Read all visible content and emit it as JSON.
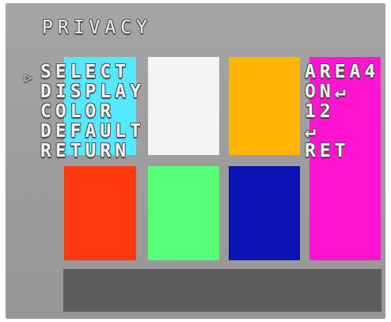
{
  "screen": {
    "title": "PRIVACY",
    "cursor_glyph": "▷",
    "menu": [
      {
        "label": "SELECT",
        "value": "AREA4"
      },
      {
        "label": "DISPLAY",
        "value": "ON↵"
      },
      {
        "label": "COLOR",
        "value": "12"
      },
      {
        "label": "DEFAULT",
        "value": "↵"
      },
      {
        "label": "RETURN",
        "value": "RET"
      }
    ],
    "selected_index": 0
  },
  "color_palette": {
    "swatches": [
      {
        "name": "cyan",
        "color": "#55e8ff"
      },
      {
        "name": "white",
        "color": "#f4f4f4"
      },
      {
        "name": "orange",
        "color": "#ffb400"
      },
      {
        "name": "magenta",
        "color": "#ff14d2"
      },
      {
        "name": "red",
        "color": "#ff3a10"
      },
      {
        "name": "green",
        "color": "#55ff78"
      },
      {
        "name": "blue",
        "color": "#0a14b4"
      }
    ],
    "status_bar_color": "#5d5d5d"
  }
}
